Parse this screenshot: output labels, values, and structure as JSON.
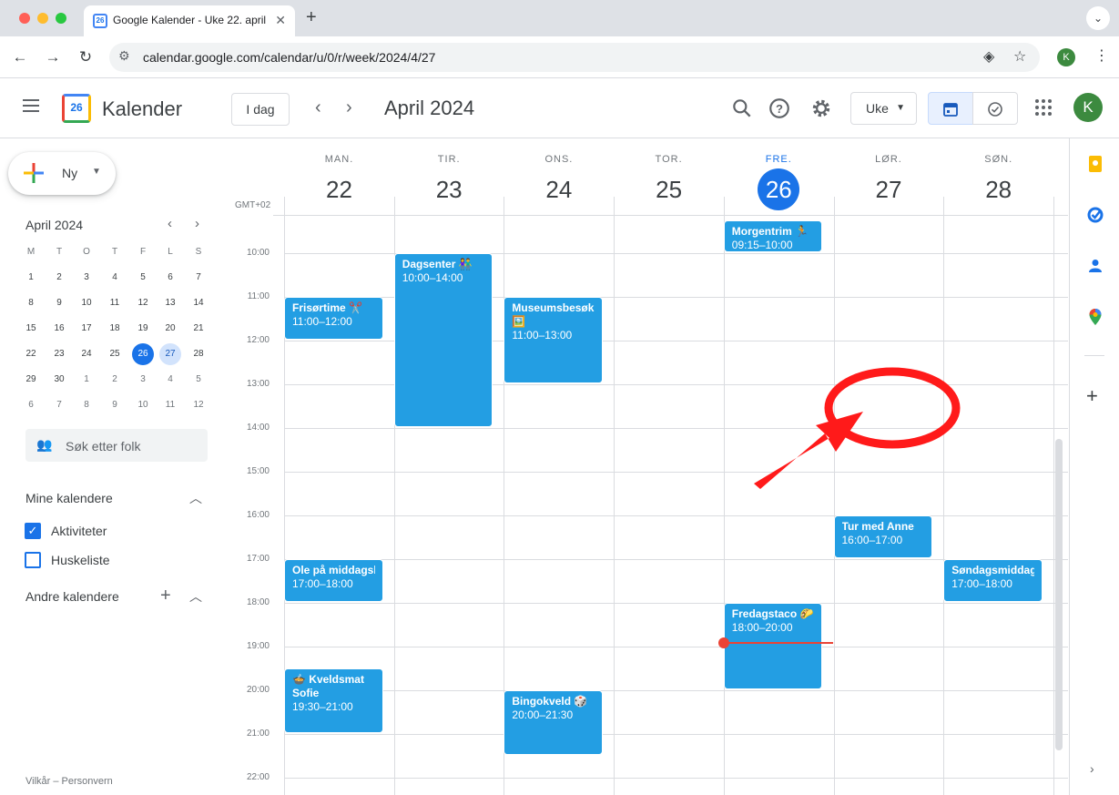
{
  "browser": {
    "tab_title": "Google Kalender - Uke 22. april 2024",
    "tab_favicon_text": "26",
    "url": "calendar.google.com/calendar/u/0/r/week/2024/4/27",
    "profile_initial": "K"
  },
  "header": {
    "app_name": "Kalender",
    "logo_number": "26",
    "today_label": "I dag",
    "current_range": "April 2024",
    "view_label": "Uke",
    "avatar_initial": "K"
  },
  "sidebar": {
    "create_label": "Ny",
    "mini_calendar": {
      "title": "April 2024",
      "weekdays": [
        "M",
        "T",
        "O",
        "T",
        "F",
        "L",
        "S"
      ],
      "weeks": [
        [
          "1",
          "2",
          "3",
          "4",
          "5",
          "6",
          "7"
        ],
        [
          "8",
          "9",
          "10",
          "11",
          "12",
          "13",
          "14"
        ],
        [
          "15",
          "16",
          "17",
          "18",
          "19",
          "20",
          "21"
        ],
        [
          "22",
          "23",
          "24",
          "25",
          "26",
          "27",
          "28"
        ],
        [
          "29",
          "30",
          "1",
          "2",
          "3",
          "4",
          "5"
        ],
        [
          "6",
          "7",
          "8",
          "9",
          "10",
          "11",
          "12"
        ]
      ],
      "today": "26",
      "selected": "27"
    },
    "people_search_placeholder": "Søk etter folk",
    "my_calendars_title": "Mine kalendere",
    "my_calendars": [
      {
        "label": "Aktiviteter",
        "checked": true
      },
      {
        "label": "Huskeliste",
        "checked": false
      }
    ],
    "other_calendars_title": "Andre kalendere",
    "footer": "Vilkår – Personvern"
  },
  "week": {
    "timezone": "GMT+02",
    "days": [
      {
        "dow": "MAN.",
        "num": "22",
        "today": false
      },
      {
        "dow": "TIR.",
        "num": "23",
        "today": false
      },
      {
        "dow": "ONS.",
        "num": "24",
        "today": false
      },
      {
        "dow": "TOR.",
        "num": "25",
        "today": false
      },
      {
        "dow": "FRE.",
        "num": "26",
        "today": true
      },
      {
        "dow": "LØR.",
        "num": "27",
        "today": false
      },
      {
        "dow": "SØN.",
        "num": "28",
        "today": false
      }
    ],
    "hours": [
      "10:00",
      "11:00",
      "12:00",
      "13:00",
      "14:00",
      "15:00",
      "16:00",
      "17:00",
      "18:00",
      "19:00",
      "20:00",
      "21:00",
      "22:00"
    ],
    "current_time": "18:55",
    "events": [
      {
        "day": 0,
        "title": "Frisørtime ✂️",
        "time": "11:00–12:00",
        "start": 11.0,
        "end": 12.0
      },
      {
        "day": 0,
        "title": "Ole på middagsbesøk",
        "time": "17:00–18:00",
        "start": 17.0,
        "end": 18.0
      },
      {
        "day": 0,
        "title": "🍲 Kveldsmat Sofie",
        "time": "19:30–21:00",
        "start": 19.5,
        "end": 21.0
      },
      {
        "day": 1,
        "title": "Dagsenter 👫",
        "time": "10:00–14:00",
        "start": 10.0,
        "end": 14.0
      },
      {
        "day": 2,
        "title": "Museumsbesøk 🖼️",
        "time": "11:00–13:00",
        "start": 11.0,
        "end": 13.0
      },
      {
        "day": 2,
        "title": "Bingokveld 🎲",
        "time": "20:00–21:30",
        "start": 20.0,
        "end": 21.5
      },
      {
        "day": 4,
        "title": "Morgentrim 🏃",
        "time": "09:15–10:00",
        "start": 9.25,
        "end": 10.0
      },
      {
        "day": 4,
        "title": "Fredagstaco 🌮",
        "time": "18:00–20:00",
        "start": 18.0,
        "end": 20.0
      },
      {
        "day": 5,
        "title": "Tur med Anne",
        "time": "16:00–17:00",
        "start": 16.0,
        "end": 17.0
      },
      {
        "day": 6,
        "title": "Søndagsmiddag 🍝",
        "time": "17:00–18:00",
        "start": 17.0,
        "end": 18.0
      }
    ]
  },
  "colors": {
    "event": "#239ee3",
    "accent": "#1a73e8",
    "now": "#ea4335",
    "annotation": "#ff1a1a"
  },
  "icons": {
    "search": "search-icon",
    "help": "help-icon",
    "settings": "gear-icon",
    "apps": "apps-grid-icon",
    "keep": "keep-icon",
    "tasks": "tasks-icon",
    "contacts": "contacts-icon",
    "maps": "maps-icon"
  }
}
